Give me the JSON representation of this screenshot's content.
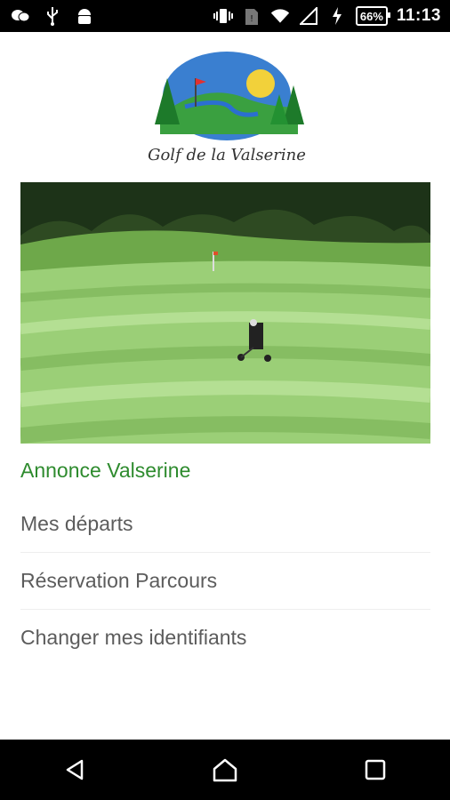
{
  "status_bar": {
    "battery_percent": "66%",
    "time": "11:13",
    "icons": [
      "wechat-icon",
      "usb-icon",
      "android-icon",
      "vibrate-icon",
      "sim-icon",
      "wifi-icon",
      "signal-icon",
      "charging-icon"
    ]
  },
  "logo": {
    "text": "Golf de la Valserine"
  },
  "menu": {
    "items": [
      {
        "label": "Annonce Valserine",
        "active": true
      },
      {
        "label": "Mes départs"
      },
      {
        "label": "Réservation Parcours"
      },
      {
        "label": "Changer mes identifiants"
      }
    ]
  },
  "colors": {
    "accent": "#2e8b2e",
    "text": "#5c5c5c",
    "bars": "#000000"
  },
  "nav_bar": {
    "icons": [
      "back-icon",
      "home-icon",
      "recents-icon"
    ]
  }
}
